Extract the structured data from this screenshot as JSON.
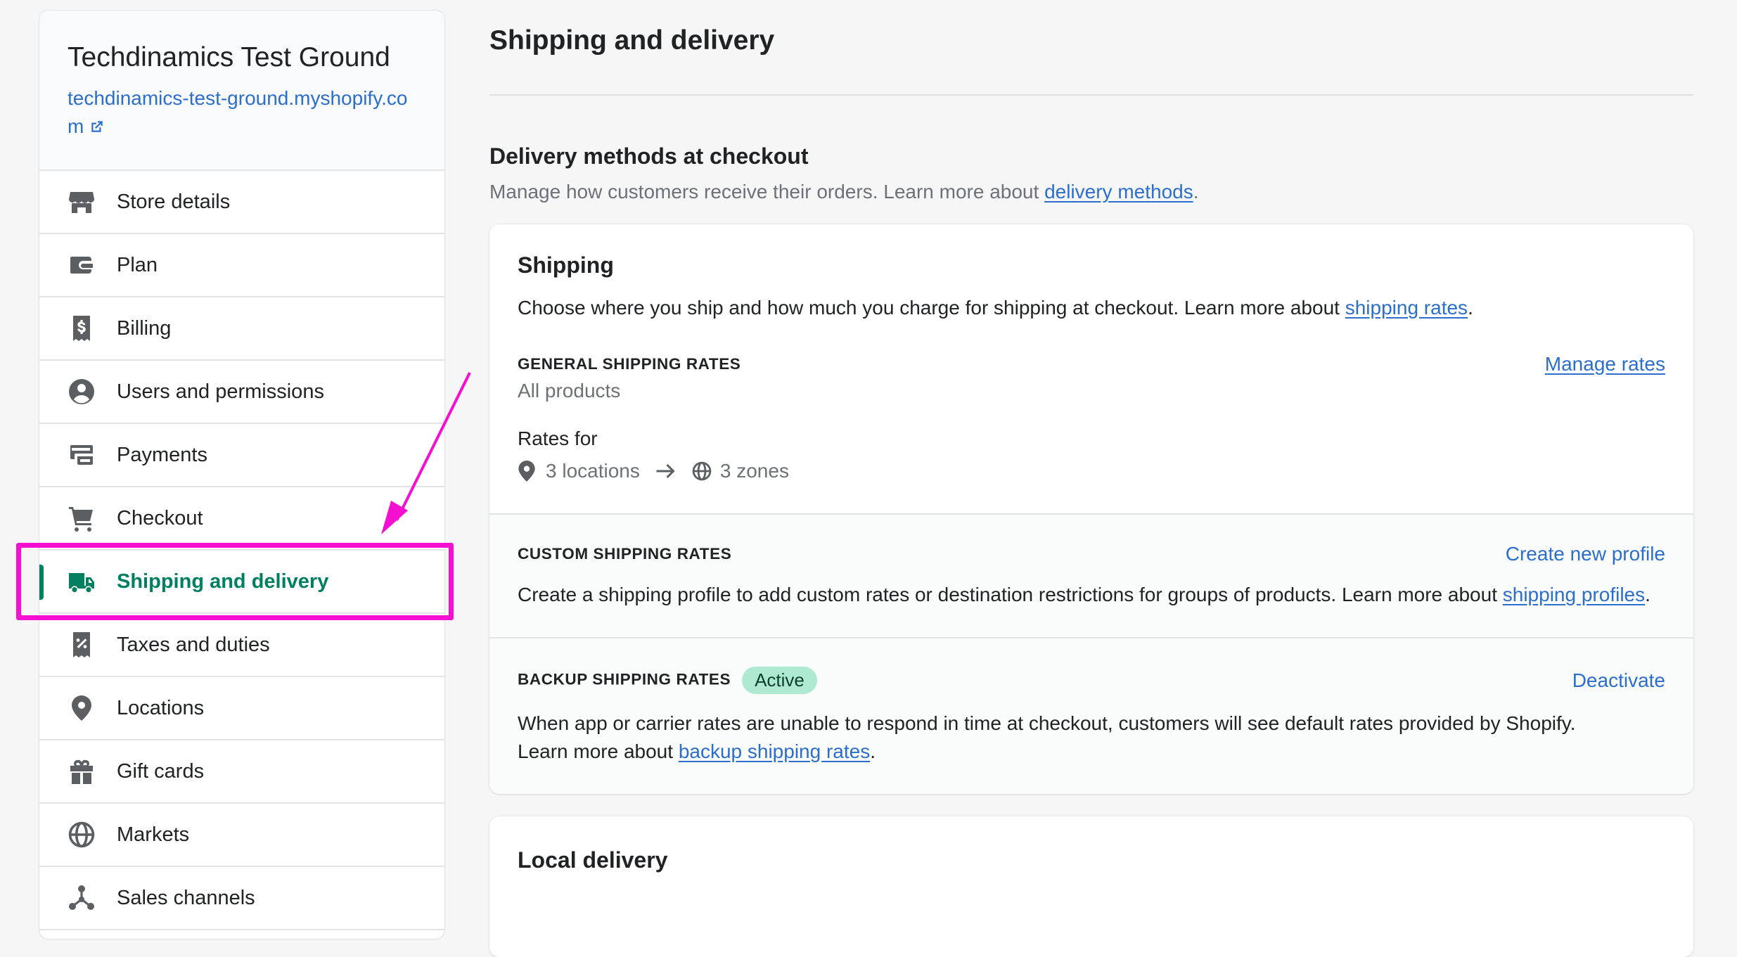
{
  "sidebar": {
    "store_name": "Techdinamics Test Ground",
    "store_url": "techdinamics-test-ground.myshopify.com",
    "items": [
      {
        "label": "Store details",
        "icon": "store-icon"
      },
      {
        "label": "Plan",
        "icon": "wallet-icon"
      },
      {
        "label": "Billing",
        "icon": "billing-receipt-icon"
      },
      {
        "label": "Users and permissions",
        "icon": "user-circle-icon"
      },
      {
        "label": "Payments",
        "icon": "payments-icon"
      },
      {
        "label": "Checkout",
        "icon": "cart-icon"
      },
      {
        "label": "Shipping and delivery",
        "icon": "truck-icon",
        "active": true
      },
      {
        "label": "Taxes and duties",
        "icon": "tax-receipt-icon"
      },
      {
        "label": "Locations",
        "icon": "location-pin-icon"
      },
      {
        "label": "Gift cards",
        "icon": "gift-icon"
      },
      {
        "label": "Markets",
        "icon": "globe-icon"
      },
      {
        "label": "Sales channels",
        "icon": "channels-icon"
      }
    ]
  },
  "main": {
    "title": "Shipping and delivery",
    "section": {
      "title": "Delivery methods at checkout",
      "desc_prefix": "Manage how customers receive their orders. Learn more about ",
      "desc_link": "delivery methods",
      "desc_suffix": "."
    },
    "shipping_card": {
      "title": "Shipping",
      "desc_prefix": "Choose where you ship and how much you charge for shipping at checkout. Learn more about ",
      "desc_link": "shipping rates",
      "desc_suffix": ".",
      "general": {
        "heading": "GENERAL SHIPPING RATES",
        "sub": "All products",
        "action": "Manage rates",
        "rates_for": "Rates for",
        "locations": "3 locations",
        "zones": "3 zones"
      },
      "custom": {
        "heading": "CUSTOM SHIPPING RATES",
        "action": "Create new profile",
        "desc_prefix": "Create a shipping profile to add custom rates or destination restrictions for groups of products. Learn more about ",
        "desc_link": "shipping profiles",
        "desc_suffix": "."
      },
      "backup": {
        "heading": "BACKUP SHIPPING RATES",
        "badge": "Active",
        "action": "Deactivate",
        "desc_line1": "When app or carrier rates are unable to respond in time at checkout, customers will see default rates provided by Shopify.",
        "desc_prefix": "Learn more about ",
        "desc_link": "backup shipping rates",
        "desc_suffix": "."
      }
    },
    "local_card": {
      "title": "Local delivery"
    }
  },
  "colors": {
    "accent": "#008060",
    "link": "#2c6ecb",
    "highlight": "#f50fd0",
    "badge_bg": "#aee9d1"
  }
}
